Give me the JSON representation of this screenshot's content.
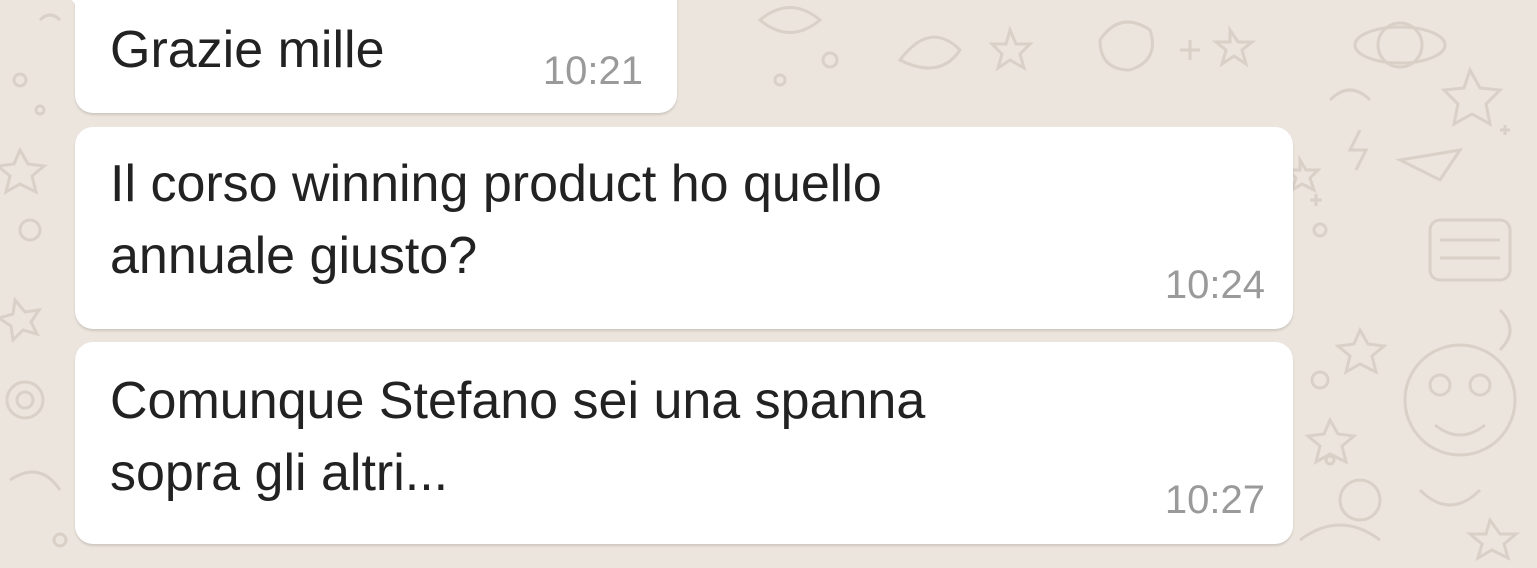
{
  "colors": {
    "wallpaper": "#ece5dd",
    "doodle": "#d9d1c7",
    "bubble": "#ffffff",
    "message_text": "#222222",
    "timestamp": "#9a9a9a"
  },
  "messages": [
    {
      "text": "Grazie mille",
      "time": "10:21",
      "direction": "incoming",
      "has_tail": true
    },
    {
      "text": "Il corso winning product ho quello\nannuale giusto?",
      "time": "10:24",
      "direction": "incoming",
      "has_tail": false
    },
    {
      "text": "Comunque Stefano sei una spanna\nsopra gli altri...",
      "time": "10:27",
      "direction": "incoming",
      "has_tail": false
    }
  ]
}
